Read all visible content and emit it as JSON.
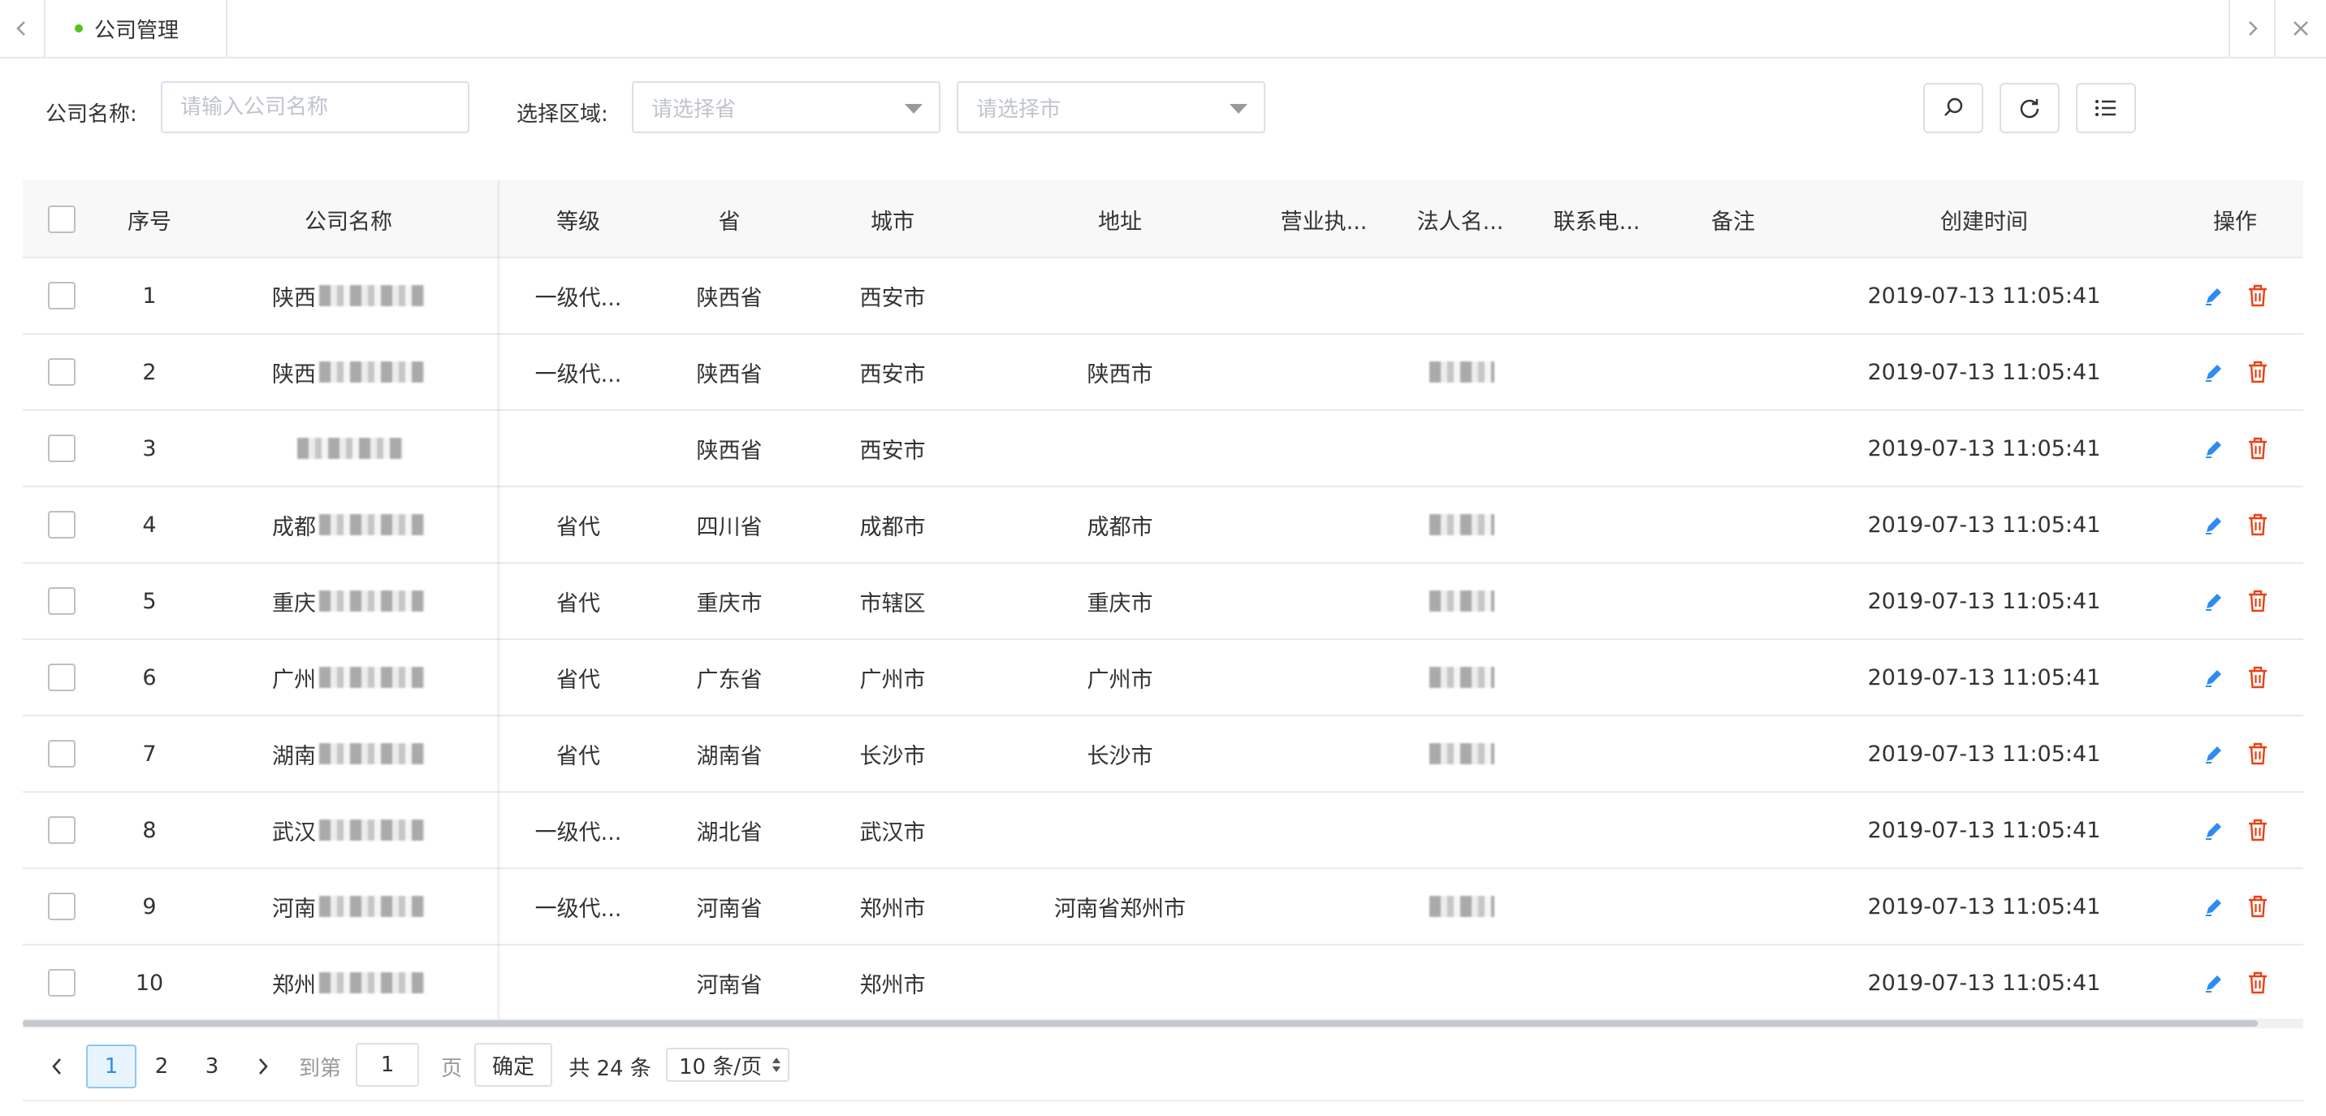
{
  "tabbar": {
    "tabs": [
      {
        "label": "公司管理",
        "active": true
      }
    ],
    "icons": {
      "prev": "chevron-left-icon",
      "next": "chevron-right-icon",
      "close": "close-icon"
    }
  },
  "filters": {
    "company_label": "公司名称:",
    "company_placeholder": "请输入公司名称",
    "region_label": "选择区域:",
    "province_placeholder": "请选择省",
    "city_placeholder": "请选择市",
    "icons": {
      "search": "search-icon",
      "refresh": "refresh-icon",
      "columns": "list-icon"
    }
  },
  "table": {
    "columns": [
      "序号",
      "公司名称",
      "等级",
      "省",
      "城市",
      "地址",
      "营业执...",
      "法人名...",
      "联系电...",
      "备注",
      "创建时间",
      "操作"
    ],
    "rows": [
      {
        "index": "1",
        "company": "陕西",
        "level": "一级代...",
        "province": "陕西省",
        "city": "西安市",
        "address": "",
        "legal": "",
        "created": "2019-07-13 11:05:41"
      },
      {
        "index": "2",
        "company": "陕西",
        "level": "一级代...",
        "province": "陕西省",
        "city": "西安市",
        "address": "陕西市",
        "legal": "blur",
        "created": "2019-07-13 11:05:41"
      },
      {
        "index": "3",
        "company": "",
        "level": "",
        "province": "陕西省",
        "city": "西安市",
        "address": "",
        "legal": "",
        "created": "2019-07-13 11:05:41"
      },
      {
        "index": "4",
        "company": "成都",
        "level": "省代",
        "province": "四川省",
        "city": "成都市",
        "address": "成都市",
        "legal": "blur",
        "created": "2019-07-13 11:05:41"
      },
      {
        "index": "5",
        "company": "重庆",
        "level": "省代",
        "province": "重庆市",
        "city": "市辖区",
        "address": "重庆市",
        "legal": "blur",
        "created": "2019-07-13 11:05:41"
      },
      {
        "index": "6",
        "company": "广州",
        "level": "省代",
        "province": "广东省",
        "city": "广州市",
        "address": "广州市",
        "legal": "blur",
        "created": "2019-07-13 11:05:41"
      },
      {
        "index": "7",
        "company": "湖南",
        "level": "省代",
        "province": "湖南省",
        "city": "长沙市",
        "address": "长沙市",
        "legal": "blur",
        "created": "2019-07-13 11:05:41"
      },
      {
        "index": "8",
        "company": "武汉",
        "level": "一级代...",
        "province": "湖北省",
        "city": "武汉市",
        "address": "",
        "legal": "",
        "created": "2019-07-13 11:05:41"
      },
      {
        "index": "9",
        "company": "河南",
        "level": "一级代...",
        "province": "河南省",
        "city": "郑州市",
        "address": "河南省郑州市",
        "legal": "blur",
        "created": "2019-07-13 11:05:41"
      },
      {
        "index": "10",
        "company": "郑州",
        "level": "",
        "province": "河南省",
        "city": "郑州市",
        "address": "",
        "legal": "",
        "created": "2019-07-13 11:05:41"
      }
    ],
    "action_icons": [
      "edit-icon",
      "delete-icon"
    ],
    "colors": {
      "edit": "#2d8cf0",
      "delete": "#ed4014"
    }
  },
  "pagination": {
    "pages": [
      "1",
      "2",
      "3"
    ],
    "current": "1",
    "goto_label": "到第",
    "goto_value": "1",
    "page_unit": "页",
    "confirm_label": "确定",
    "total_label": "共 24 条",
    "page_size_label": "10 条/页"
  }
}
